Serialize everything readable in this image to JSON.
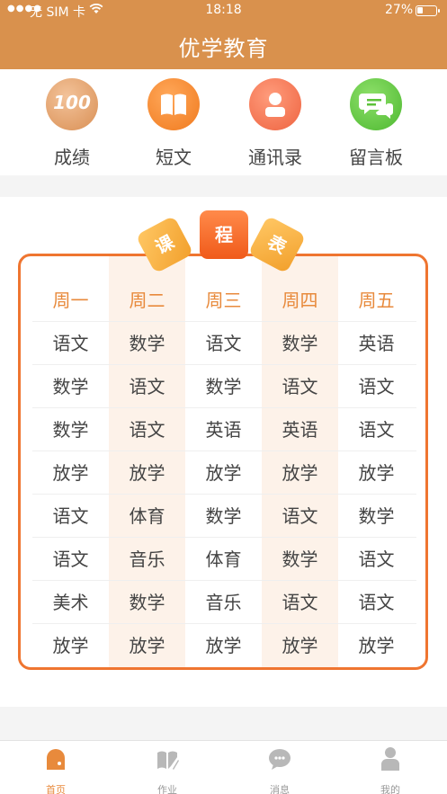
{
  "status_bar": {
    "carrier": "无 SIM 卡",
    "time": "18:18",
    "battery": "27%"
  },
  "header": {
    "title": "优学教育"
  },
  "quick_menu": [
    {
      "label": "成绩",
      "icon": "score-100-icon",
      "icon_text": "100"
    },
    {
      "label": "短文",
      "icon": "open-book-icon"
    },
    {
      "label": "通讯录",
      "icon": "contact-person-icon"
    },
    {
      "label": "留言板",
      "icon": "chat-bubbles-icon"
    }
  ],
  "schedule": {
    "badges": [
      "课",
      "程",
      "表"
    ],
    "days": [
      "周一",
      "周二",
      "周三",
      "周四",
      "周五"
    ],
    "rows": [
      [
        "语文",
        "数学",
        "语文",
        "数学",
        "英语"
      ],
      [
        "数学",
        "语文",
        "数学",
        "语文",
        "语文"
      ],
      [
        "数学",
        "语文",
        "英语",
        "英语",
        "语文"
      ],
      [
        "放学",
        "放学",
        "放学",
        "放学",
        "放学"
      ],
      [
        "语文",
        "体育",
        "数学",
        "语文",
        "数学"
      ],
      [
        "语文",
        "音乐",
        "体育",
        "数学",
        "语文"
      ],
      [
        "美术",
        "数学",
        "音乐",
        "语文",
        "语文"
      ],
      [
        "放学",
        "放学",
        "放学",
        "放学",
        "放学"
      ]
    ]
  },
  "tabbar": [
    {
      "label": "首页",
      "icon": "home-icon",
      "active": true
    },
    {
      "label": "作业",
      "icon": "homework-book-icon",
      "active": false
    },
    {
      "label": "消息",
      "icon": "message-bubble-icon",
      "active": false
    },
    {
      "label": "我的",
      "icon": "person-icon",
      "active": false
    }
  ],
  "colors": {
    "header": "#d9914d",
    "accent": "#ef7530",
    "active_tab": "#e88a3c",
    "inactive_tab": "#b8b8b8"
  }
}
